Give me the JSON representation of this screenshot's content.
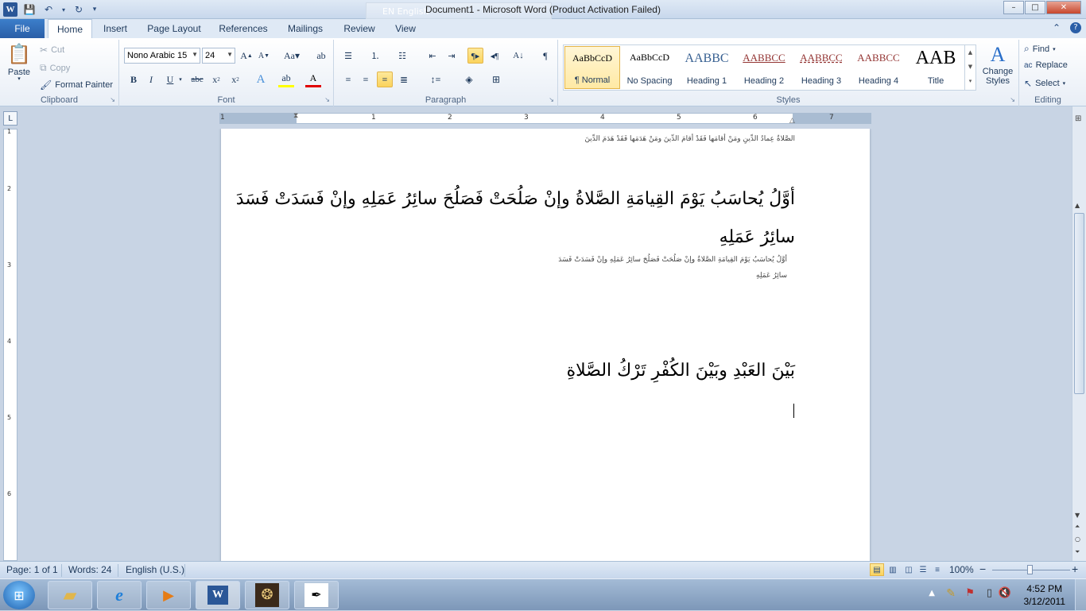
{
  "window": {
    "title": "Document1  -  Microsoft Word (Product Activation Failed)",
    "language_indicator": "EN English",
    "controls": {
      "minimize": "–",
      "maximize": "□",
      "close": "✕"
    }
  },
  "ribbon_tabs": [
    "File",
    "Home",
    "Insert",
    "Page Layout",
    "References",
    "Mailings",
    "Review",
    "View"
  ],
  "active_tab": "Home",
  "clipboard": {
    "label": "Clipboard",
    "paste": "Paste",
    "cut": "Cut",
    "copy": "Copy",
    "format_painter": "Format Painter"
  },
  "font": {
    "label": "Font",
    "name": "Nono Arabic 15",
    "size": "24"
  },
  "paragraph": {
    "label": "Paragraph"
  },
  "styles": {
    "label": "Styles",
    "items": [
      {
        "preview": "AaBbCcD",
        "name": "¶ Normal"
      },
      {
        "preview": "AaBbCcD",
        "name": "No Spacing"
      },
      {
        "preview": "AABBC",
        "name": "Heading 1"
      },
      {
        "preview": "AABBCC",
        "name": "Heading 2"
      },
      {
        "preview": "AABBCC",
        "name": "Heading 3"
      },
      {
        "preview": "AABBCC",
        "name": "Heading 4"
      },
      {
        "preview": "AAB",
        "name": "Title"
      }
    ],
    "change_styles": "Change Styles"
  },
  "editing": {
    "label": "Editing",
    "find": "Find",
    "replace": "Replace",
    "select": "Select"
  },
  "document": {
    "line_small_top": "الصَّلاةُ عِمادُ الدِّينِ ومَنْ أقامَها فَقَدْ أقامَ الدِّينَ ومَنْ هَدَمَها فَقَدْ هَدَمَ الدِّينَ",
    "line_large_1": "أوَّلُ يُحاسَبُ يَوْمَ القِيامَةِ الصَّلاةُ وإنْ صَلُحَتْ فَصَلُحَ سائِرُ عَمَلِهِ وإنْ فَسَدَتْ فَسَدَ",
    "line_large_2": "سائِرُ عَمَلِهِ",
    "line_small_1": "أوَّلُ يُحاسَبُ يَوْمَ القِيامَةِ الصَّلاةُ وإنْ صَلُحَتْ فَصَلُحَ سائِرُ عَمَلِهِ وإنْ فَسَدَتْ فَسَدَ",
    "line_small_2": "سائِرُ عَمَلِهِ",
    "line_large_3": "بَيْنَ العَبْدِ وبَيْنَ الكُفْرِ تَرْكُ الصَّلاةِ"
  },
  "ruler_numbers": [
    "1",
    "1",
    "2",
    "3",
    "4",
    "5",
    "6",
    "7"
  ],
  "vruler_numbers": [
    "1",
    "2",
    "3",
    "4",
    "5",
    "6"
  ],
  "status_bar": {
    "page": "Page: 1 of 1",
    "words": "Words: 24",
    "language": "English (U.S.)",
    "zoom": "100%",
    "zoom_minus": "−",
    "zoom_plus": "+"
  },
  "taskbar": {
    "time": "4:52 PM",
    "date": "3/12/2011"
  }
}
